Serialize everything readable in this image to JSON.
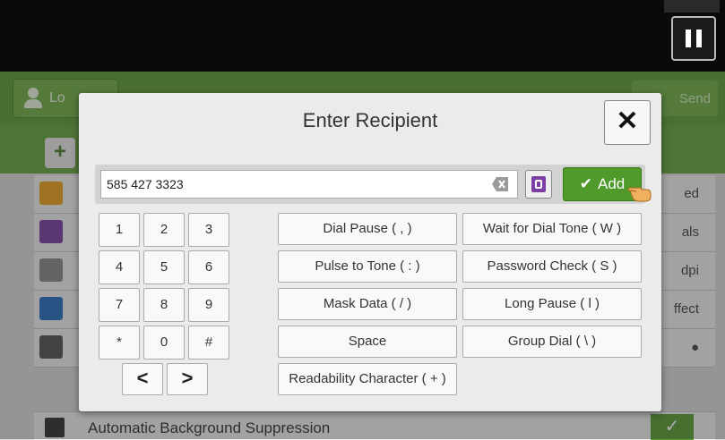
{
  "header": {
    "login_label": "Lo",
    "send_label": "Send"
  },
  "background_rows": [
    {
      "right_text": "ed",
      "icon_color": "#e8a020"
    },
    {
      "right_text": "als",
      "icon_color": "#7a3fa0"
    },
    {
      "right_text": "dpi",
      "icon_color": "#888888"
    },
    {
      "right_text": "ffect",
      "icon_color": "#2a6fc0"
    },
    {
      "right_text": "●",
      "icon_color": "#555555"
    }
  ],
  "bottom_row": {
    "label": "Automatic Background Suppression",
    "check": "✓"
  },
  "dialog": {
    "title": "Enter Recipient",
    "close_glyph": "✕",
    "input_value": "585 427 3323",
    "add_label": "Add",
    "check_glyph": "✔"
  },
  "keypad": {
    "keys": [
      "1",
      "2",
      "3",
      "4",
      "5",
      "6",
      "7",
      "8",
      "9",
      "*",
      "0",
      "#"
    ],
    "prev_glyph": "<",
    "next_glyph": ">"
  },
  "functions": {
    "left": [
      "Dial Pause ( , )",
      "Pulse to Tone ( : )",
      "Mask Data ( / )",
      "Space",
      "Readability Character ( + )"
    ],
    "right": [
      "Wait for Dial Tone ( W )",
      "Password Check ( S )",
      "Long Pause ( l )",
      "Group Dial ( \\ )"
    ]
  },
  "colors": {
    "accent_green": "#4f9a2a",
    "header_green": "#5f9b3a",
    "address_book_purple": "#7d3fa6"
  },
  "icons": [
    "pause-icon",
    "person-icon",
    "plus-icon",
    "close-icon",
    "backspace-icon",
    "address-book-icon",
    "check-icon",
    "hand-pointer-icon",
    "chevron-left-icon",
    "chevron-right-icon"
  ]
}
